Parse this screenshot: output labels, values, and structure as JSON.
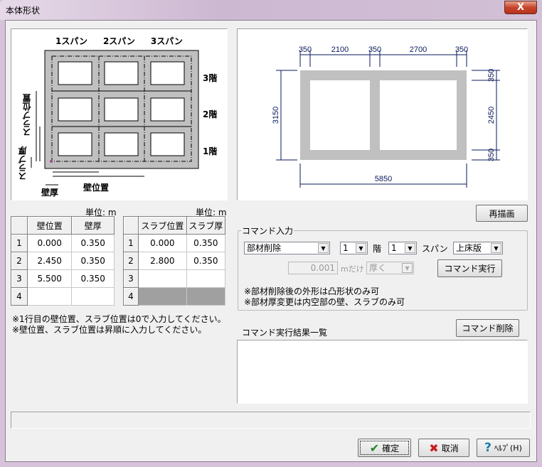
{
  "window": {
    "title": "本体形状",
    "close": "X"
  },
  "diagram_left": {
    "spans": [
      "1スパン",
      "2スパン",
      "3スパン"
    ],
    "floors": [
      "3階",
      "2階",
      "1階"
    ],
    "slab_pos": "スラブ位置",
    "slab_thick": "スラブ厚",
    "wall_thick": "壁厚",
    "wall_pos": "壁位置"
  },
  "diagram_right": {
    "top_dims": [
      "350",
      "2100",
      "350",
      "2700",
      "350"
    ],
    "left_dim": "3150",
    "bottom_dim": "5850",
    "right_dims": [
      "350",
      "2450",
      "350"
    ],
    "line_color": "#0a1a5c",
    "fill_color": "#c0c0c0"
  },
  "wall_table": {
    "unit": "単位: m",
    "headers": [
      "壁位置",
      "壁厚"
    ],
    "rows": [
      {
        "no": "1",
        "pos": "0.000",
        "thick": "0.350"
      },
      {
        "no": "2",
        "pos": "2.450",
        "thick": "0.350"
      },
      {
        "no": "3",
        "pos": "5.500",
        "thick": "0.350"
      },
      {
        "no": "4",
        "pos": "",
        "thick": ""
      }
    ]
  },
  "slab_table": {
    "unit": "単位: m",
    "headers": [
      "スラブ位置",
      "スラブ厚"
    ],
    "rows": [
      {
        "no": "1",
        "pos": "0.000",
        "thick": "0.350"
      },
      {
        "no": "2",
        "pos": "2.800",
        "thick": "0.350"
      },
      {
        "no": "3",
        "pos": "",
        "thick": ""
      },
      {
        "no": "4",
        "pos": "",
        "thick": ""
      }
    ]
  },
  "notes_left": [
    "※1行目の壁位置、スラブ位置は0で入力してください。",
    "※壁位置、スラブ位置は昇順に入力してください。"
  ],
  "redraw_button": "再描画",
  "command": {
    "group_label": "コマンド入力",
    "action": "部材削除",
    "floor": "1",
    "floor_label": "階",
    "span": "1",
    "span_label": "スパン",
    "member": "上床版",
    "amount": "0.001",
    "amount_unit": "mだけ",
    "direction": "厚く",
    "execute": "コマンド実行",
    "notes": [
      "※部材削除後の外形は凸形状のみ可",
      "※部材厚変更は内空部の壁、スラブのみ可"
    ]
  },
  "results": {
    "label": "コマンド実行結果一覧",
    "delete_button": "コマンド削除"
  },
  "footer": {
    "ok": "確定",
    "cancel": "取消",
    "help": "ﾍﾙﾌﾟ(H)"
  }
}
